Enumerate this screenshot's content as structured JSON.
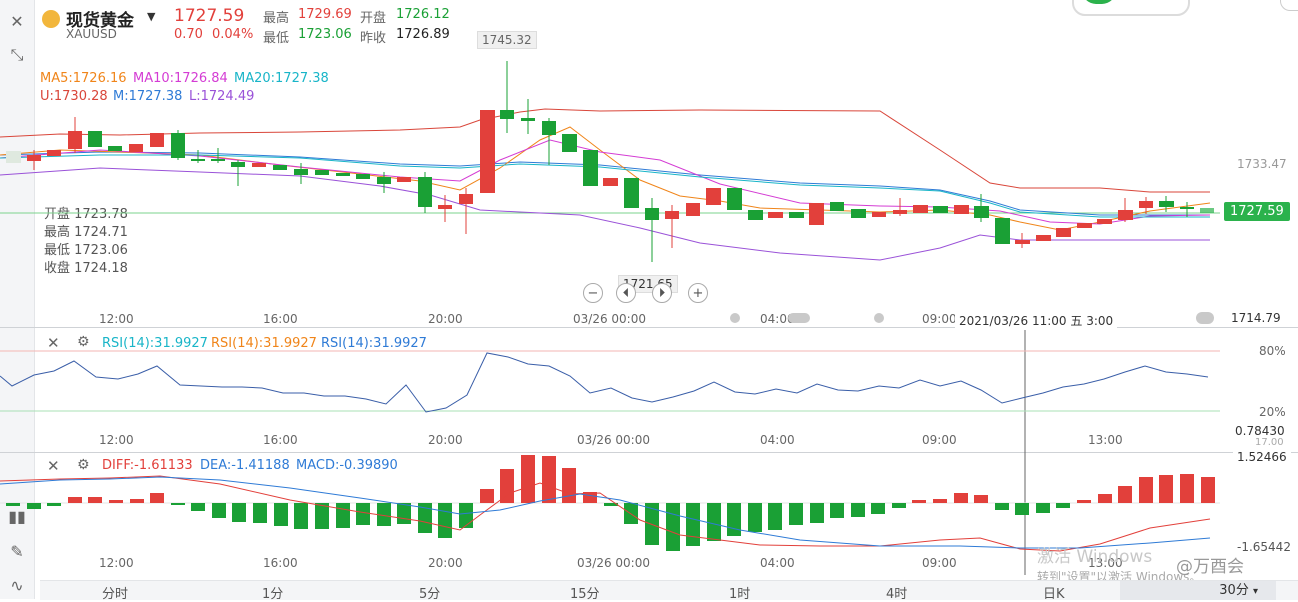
{
  "header": {
    "name": "现货黄金",
    "code": "XAUUSD",
    "price": "1727.59",
    "change": "0.70",
    "change_pct": "0.04%",
    "high_label": "最高",
    "high": "1729.69",
    "low_label": "最低",
    "low": "1723.06",
    "open_label": "开盘",
    "open": "1726.12",
    "prev_label": "昨收",
    "prev": "1726.89"
  },
  "indicators": {
    "ma5": "MA5:1726.16",
    "ma10": "MA10:1726.84",
    "ma20": "MA20:1727.38",
    "u": "U:1730.28",
    "m": "M:1727.38",
    "l": "L:1724.49"
  },
  "tooltip": {
    "open": "开盘 1723.78",
    "high": "最高 1724.71",
    "low": "最低 1723.06",
    "close": "收盘 1724.18"
  },
  "main_chart": {
    "peak_label": "1745.32",
    "trough_label": "1721.65",
    "right_level": "1733.47",
    "current_price": "1727.59",
    "bottom_value": "1714.79",
    "crosshair_time": "2021/03/26 11:00 五 3:00",
    "x_labels": [
      "12:00",
      "16:00",
      "20:00",
      "03/26 00:00",
      "04:00",
      "09:00"
    ]
  },
  "rsi": {
    "label1": "RSI(14):31.9927",
    "label2": "RSI(14):31.9927",
    "label3": "RSI(14):31.9927",
    "level_high": "80%",
    "level_low": "20%",
    "x_labels": [
      "12:00",
      "16:00",
      "20:00",
      "03/26 00:00",
      "04:00",
      "09:00",
      "13:00"
    ],
    "right_value": "0.78430",
    "right_partial": "17.00"
  },
  "macd": {
    "diff": "DIFF:-1.61133",
    "dea": "DEA:-1.41188",
    "macd": "MACD:-0.39890",
    "top_value": "1.52466",
    "bottom_value": "-1.65442",
    "x_labels": [
      "12:00",
      "16:00",
      "20:00",
      "03/26 00:00",
      "04:00",
      "09:00",
      "13:00"
    ]
  },
  "tabs": [
    "分时",
    "1分",
    "5分",
    "15分",
    "1时",
    "4时",
    "日K",
    "30分"
  ],
  "watermark": {
    "line1": "激活 Windows",
    "line2": "转到\"设置\"以激活 Windows。",
    "author": "@万酉会"
  },
  "colors": {
    "up": "#e2403b",
    "down": "#1aa035",
    "ma5": "#f0851a",
    "ma10": "#d43cd4",
    "ma20": "#19b5c8",
    "boll_u": "#d9463a",
    "boll_m": "#2f7bd6",
    "boll_l": "#9a52d8"
  }
}
